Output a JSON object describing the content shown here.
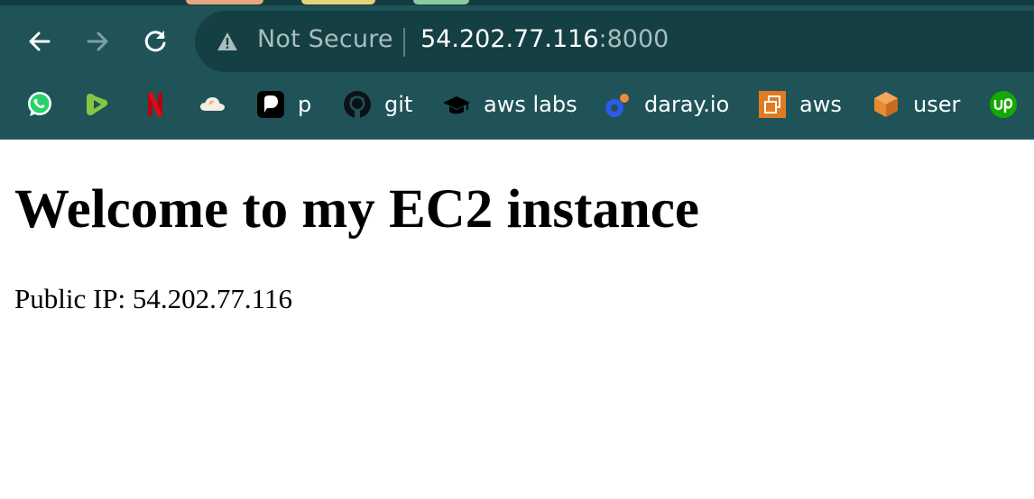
{
  "browser": {
    "security_label": "Not Secure",
    "url_host": "54.202.77.116",
    "url_port": ":8000",
    "bookmarks": [
      {
        "icon": "whatsapp-icon",
        "label": ""
      },
      {
        "icon": "rumble-icon",
        "label": ""
      },
      {
        "icon": "netflix-icon",
        "label": ""
      },
      {
        "icon": "cloud-icon",
        "label": ""
      },
      {
        "icon": "p-app-icon",
        "label": "p"
      },
      {
        "icon": "github-icon",
        "label": "git"
      },
      {
        "icon": "graduation-cap-icon",
        "label": "aws labs"
      },
      {
        "icon": "daray-icon",
        "label": "daray.io"
      },
      {
        "icon": "aws-console-icon",
        "label": "aws"
      },
      {
        "icon": "cube-icon",
        "label": "user"
      },
      {
        "icon": "upwork-icon",
        "label": ""
      }
    ],
    "colors": {
      "toolbar": "#1f5357",
      "omnibox": "#143f43"
    }
  },
  "page": {
    "heading": "Welcome to my EC2 instance",
    "public_ip_text": "Public IP: 54.202.77.116"
  }
}
